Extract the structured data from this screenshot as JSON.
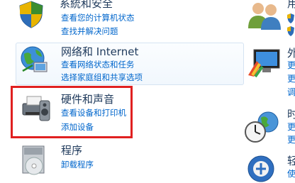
{
  "categories": [
    {
      "id": "security",
      "title": "系統和安全",
      "links": [
        "查看您的计算机状态",
        "查找并解决问题"
      ]
    },
    {
      "id": "network",
      "title": "网络和 Internet",
      "links": [
        "查看网络状态和任务",
        "选择家庭组和共享选项"
      ]
    },
    {
      "id": "hardware",
      "title": "硬件和声音",
      "links": [
        "查看设备和打印机",
        "添加设备"
      ]
    },
    {
      "id": "programs",
      "title": "程序",
      "links": [
        "卸载程序"
      ]
    }
  ],
  "right_column": {
    "user_accounts_title": "用",
    "appearance_title": "外",
    "appearance_links": [
      "更",
      "更",
      "调"
    ],
    "clock_title": "时",
    "clock_links": [
      "更",
      "更"
    ],
    "ease_title": "轻",
    "ease_links": [
      "使"
    ]
  },
  "colors": {
    "title": "#1e395b",
    "link": "#0066cc",
    "highlight": "#e02020"
  }
}
